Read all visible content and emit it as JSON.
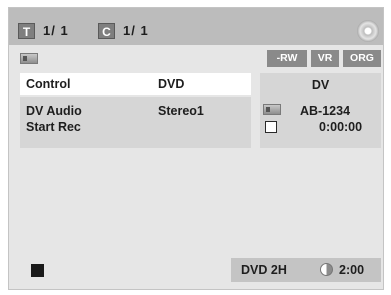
{
  "header": {
    "title_icon": "T",
    "title_value": "1/ 1",
    "chapter_icon": "C",
    "chapter_value": "1/ 1",
    "disc_icon": "disc-icon"
  },
  "badges": {
    "disc_type": "-RW",
    "mode": "VR",
    "status": "ORG"
  },
  "menu": {
    "control_label": "Control",
    "control_value": "DVD",
    "dv_audio_label": "DV Audio",
    "dv_audio_value": "Stereo1",
    "start_rec_label": "Start Rec"
  },
  "dv_panel": {
    "title": "DV",
    "tape_code": "AB-1234",
    "timecode": "0:00:00"
  },
  "status_bar": {
    "mode": "DVD 2H",
    "remaining": "2:00"
  }
}
